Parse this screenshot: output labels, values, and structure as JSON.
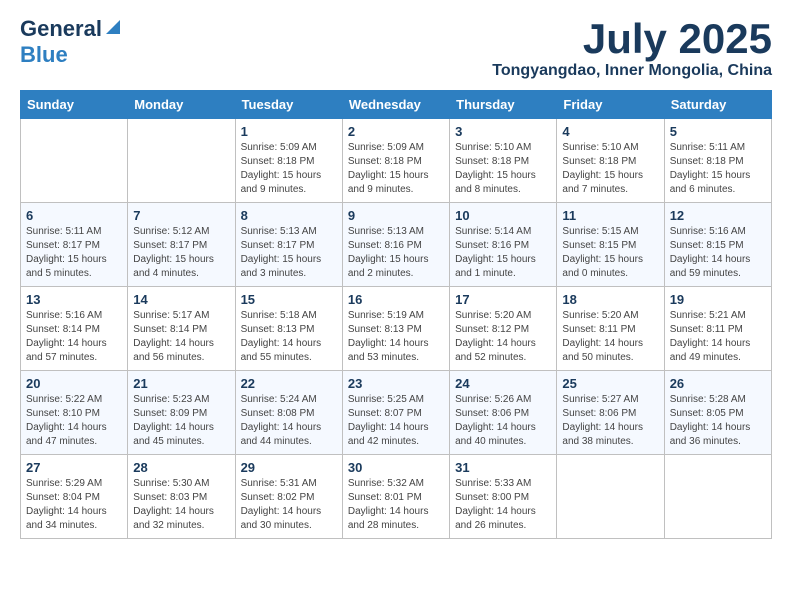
{
  "logo": {
    "general": "General",
    "blue": "Blue"
  },
  "title": "July 2025",
  "location": "Tongyangdao, Inner Mongolia, China",
  "days_of_week": [
    "Sunday",
    "Monday",
    "Tuesday",
    "Wednesday",
    "Thursday",
    "Friday",
    "Saturday"
  ],
  "weeks": [
    [
      {
        "day": "",
        "info": ""
      },
      {
        "day": "",
        "info": ""
      },
      {
        "day": "1",
        "info": "Sunrise: 5:09 AM\nSunset: 8:18 PM\nDaylight: 15 hours and 9 minutes."
      },
      {
        "day": "2",
        "info": "Sunrise: 5:09 AM\nSunset: 8:18 PM\nDaylight: 15 hours and 9 minutes."
      },
      {
        "day": "3",
        "info": "Sunrise: 5:10 AM\nSunset: 8:18 PM\nDaylight: 15 hours and 8 minutes."
      },
      {
        "day": "4",
        "info": "Sunrise: 5:10 AM\nSunset: 8:18 PM\nDaylight: 15 hours and 7 minutes."
      },
      {
        "day": "5",
        "info": "Sunrise: 5:11 AM\nSunset: 8:18 PM\nDaylight: 15 hours and 6 minutes."
      }
    ],
    [
      {
        "day": "6",
        "info": "Sunrise: 5:11 AM\nSunset: 8:17 PM\nDaylight: 15 hours and 5 minutes."
      },
      {
        "day": "7",
        "info": "Sunrise: 5:12 AM\nSunset: 8:17 PM\nDaylight: 15 hours and 4 minutes."
      },
      {
        "day": "8",
        "info": "Sunrise: 5:13 AM\nSunset: 8:17 PM\nDaylight: 15 hours and 3 minutes."
      },
      {
        "day": "9",
        "info": "Sunrise: 5:13 AM\nSunset: 8:16 PM\nDaylight: 15 hours and 2 minutes."
      },
      {
        "day": "10",
        "info": "Sunrise: 5:14 AM\nSunset: 8:16 PM\nDaylight: 15 hours and 1 minute."
      },
      {
        "day": "11",
        "info": "Sunrise: 5:15 AM\nSunset: 8:15 PM\nDaylight: 15 hours and 0 minutes."
      },
      {
        "day": "12",
        "info": "Sunrise: 5:16 AM\nSunset: 8:15 PM\nDaylight: 14 hours and 59 minutes."
      }
    ],
    [
      {
        "day": "13",
        "info": "Sunrise: 5:16 AM\nSunset: 8:14 PM\nDaylight: 14 hours and 57 minutes."
      },
      {
        "day": "14",
        "info": "Sunrise: 5:17 AM\nSunset: 8:14 PM\nDaylight: 14 hours and 56 minutes."
      },
      {
        "day": "15",
        "info": "Sunrise: 5:18 AM\nSunset: 8:13 PM\nDaylight: 14 hours and 55 minutes."
      },
      {
        "day": "16",
        "info": "Sunrise: 5:19 AM\nSunset: 8:13 PM\nDaylight: 14 hours and 53 minutes."
      },
      {
        "day": "17",
        "info": "Sunrise: 5:20 AM\nSunset: 8:12 PM\nDaylight: 14 hours and 52 minutes."
      },
      {
        "day": "18",
        "info": "Sunrise: 5:20 AM\nSunset: 8:11 PM\nDaylight: 14 hours and 50 minutes."
      },
      {
        "day": "19",
        "info": "Sunrise: 5:21 AM\nSunset: 8:11 PM\nDaylight: 14 hours and 49 minutes."
      }
    ],
    [
      {
        "day": "20",
        "info": "Sunrise: 5:22 AM\nSunset: 8:10 PM\nDaylight: 14 hours and 47 minutes."
      },
      {
        "day": "21",
        "info": "Sunrise: 5:23 AM\nSunset: 8:09 PM\nDaylight: 14 hours and 45 minutes."
      },
      {
        "day": "22",
        "info": "Sunrise: 5:24 AM\nSunset: 8:08 PM\nDaylight: 14 hours and 44 minutes."
      },
      {
        "day": "23",
        "info": "Sunrise: 5:25 AM\nSunset: 8:07 PM\nDaylight: 14 hours and 42 minutes."
      },
      {
        "day": "24",
        "info": "Sunrise: 5:26 AM\nSunset: 8:06 PM\nDaylight: 14 hours and 40 minutes."
      },
      {
        "day": "25",
        "info": "Sunrise: 5:27 AM\nSunset: 8:06 PM\nDaylight: 14 hours and 38 minutes."
      },
      {
        "day": "26",
        "info": "Sunrise: 5:28 AM\nSunset: 8:05 PM\nDaylight: 14 hours and 36 minutes."
      }
    ],
    [
      {
        "day": "27",
        "info": "Sunrise: 5:29 AM\nSunset: 8:04 PM\nDaylight: 14 hours and 34 minutes."
      },
      {
        "day": "28",
        "info": "Sunrise: 5:30 AM\nSunset: 8:03 PM\nDaylight: 14 hours and 32 minutes."
      },
      {
        "day": "29",
        "info": "Sunrise: 5:31 AM\nSunset: 8:02 PM\nDaylight: 14 hours and 30 minutes."
      },
      {
        "day": "30",
        "info": "Sunrise: 5:32 AM\nSunset: 8:01 PM\nDaylight: 14 hours and 28 minutes."
      },
      {
        "day": "31",
        "info": "Sunrise: 5:33 AM\nSunset: 8:00 PM\nDaylight: 14 hours and 26 minutes."
      },
      {
        "day": "",
        "info": ""
      },
      {
        "day": "",
        "info": ""
      }
    ]
  ]
}
